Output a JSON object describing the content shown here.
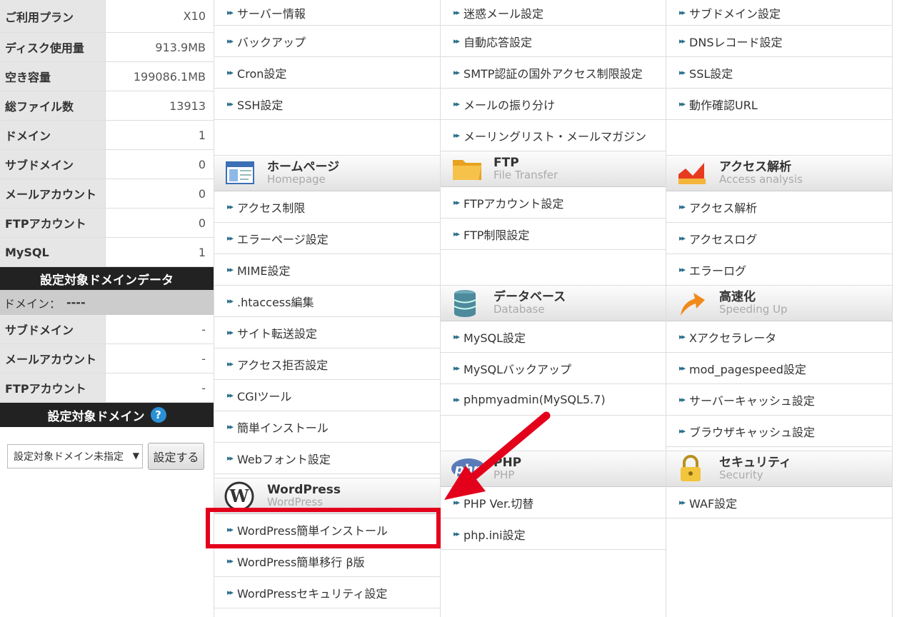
{
  "left_panel": {
    "stats": [
      {
        "label": "ご利用プラン",
        "value": "X10"
      },
      {
        "label": "ディスク使用量",
        "value": "913.9MB"
      },
      {
        "label": "空き容量",
        "value": "199086.1MB"
      },
      {
        "label": "総ファイル数",
        "value": "13913"
      },
      {
        "label": "ドメイン",
        "value": "1"
      },
      {
        "label": "サブドメイン",
        "value": "0"
      },
      {
        "label": "メールアカウント",
        "value": "0"
      },
      {
        "label": "FTPアカウント",
        "value": "0"
      },
      {
        "label": "MySQL",
        "value": "1"
      }
    ],
    "domain_data_header": "設定対象ドメインデータ",
    "domain_label": "ドメイン：",
    "domain_value": "----",
    "domain_stats": [
      {
        "label": "サブドメイン",
        "value": "-"
      },
      {
        "label": "メールアカウント",
        "value": "-"
      },
      {
        "label": "FTPアカウント",
        "value": "-"
      }
    ],
    "target_domain_header": "設定対象ドメイン",
    "help_icon": "?",
    "select_value": "設定対象ドメイン未指定",
    "select_arrow": "▼",
    "set_button": "設定する"
  },
  "col1": {
    "items_top": [
      "サーバー情報",
      "バックアップ",
      "Cron設定",
      "SSH設定"
    ],
    "homepage": {
      "title_ja": "ホームページ",
      "title_en": "Homepage",
      "icon": "homepage-window-icon"
    },
    "homepage_items": [
      "アクセス制限",
      "エラーページ設定",
      "MIME設定",
      ".htaccess編集",
      "サイト転送設定",
      "アクセス拒否設定",
      "CGIツール",
      "簡単インストール",
      "Webフォント設定"
    ],
    "wordpress": {
      "title_ja": "WordPress",
      "title_en": "WordPress",
      "icon": "wordpress-logo-icon"
    },
    "wordpress_items": [
      "WordPress簡単インストール",
      "WordPress簡単移行 β版",
      "WordPressセキュリティ設定"
    ]
  },
  "col2": {
    "items_top": [
      "迷惑メール設定",
      "自動応答設定",
      "SMTP認証の国外アクセス制限設定",
      "メールの振り分け",
      "メーリングリスト・メールマガジン"
    ],
    "ftp": {
      "title_ja": "FTP",
      "title_en": "File Transfer",
      "icon": "folder-icon"
    },
    "ftp_items": [
      "FTPアカウント設定",
      "FTP制限設定"
    ],
    "database": {
      "title_ja": "データベース",
      "title_en": "Database",
      "icon": "database-icon"
    },
    "database_items": [
      "MySQL設定",
      "MySQLバックアップ",
      "phpmyadmin(MySQL5.7)"
    ],
    "php": {
      "title_ja": "PHP",
      "title_en": "PHP",
      "icon": "php-logo-icon",
      "logo_text": "php"
    },
    "php_items": [
      "PHP Ver.切替",
      "php.ini設定"
    ]
  },
  "col3": {
    "items_top": [
      "サブドメイン設定",
      "DNSレコード設定",
      "SSL設定",
      "動作確認URL"
    ],
    "access": {
      "title_ja": "アクセス解析",
      "title_en": "Access analysis",
      "icon": "access-chart-icon"
    },
    "access_items": [
      "アクセス解析",
      "アクセスログ",
      "エラーログ"
    ],
    "speed": {
      "title_ja": "高速化",
      "title_en": "Speeding Up",
      "icon": "speed-arrow-icon"
    },
    "speed_items": [
      "Xアクセラレータ",
      "mod_pagespeed設定",
      "サーバーキャッシュ設定",
      "ブラウザキャッシュ設定"
    ],
    "security": {
      "title_ja": "セキュリティ",
      "title_en": "Security",
      "icon": "padlock-icon"
    },
    "security_items": [
      "WAF設定"
    ]
  },
  "colors": {
    "highlight": "#e3001b",
    "link_arrow": "#2b6f8a",
    "dark_header": "#222222"
  }
}
